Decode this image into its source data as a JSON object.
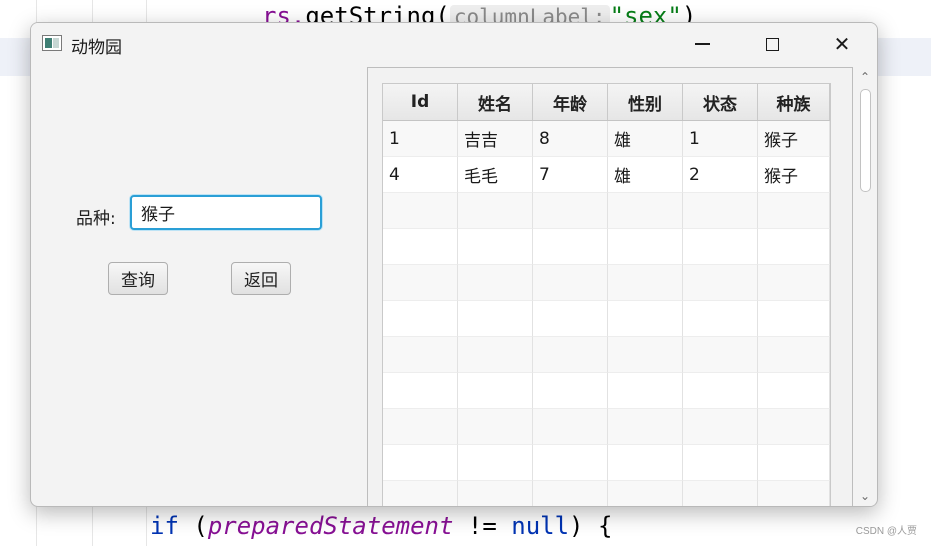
{
  "editor": {
    "top_line": {
      "prefix": "rs.",
      "method": "getString(",
      "hint": "columnLabel:",
      "arg": "\"sex\"",
      "suffix": ")"
    },
    "bottom_line": {
      "kw_if": "if",
      "open": " (",
      "field": "preparedStatement",
      "op": " != ",
      "kw_null": "null",
      "close": ") {"
    },
    "watermark": "CSDN @人贾"
  },
  "window": {
    "title": "动物园",
    "icon": "app-window-icon",
    "controls": {
      "minimize": "minimize-icon",
      "maximize": "maximize-icon",
      "close": "close-icon",
      "close_glyph": "✕"
    }
  },
  "form": {
    "breed_label": "品种:",
    "breed_value": "猴子",
    "query_button": "查询",
    "back_button": "返回"
  },
  "table": {
    "columns": [
      "Id",
      "姓名",
      "年龄",
      "性别",
      "状态",
      "种族"
    ],
    "rows": [
      [
        "1",
        "吉吉",
        "8",
        "雄",
        "1",
        "猴子"
      ],
      [
        "4",
        "毛毛",
        "7",
        "雄",
        "2",
        "猴子"
      ]
    ]
  },
  "scrollbar": {
    "up_icon": "chevron-up-icon",
    "down_icon": "chevron-down-icon",
    "up_glyph": "⌃",
    "down_glyph": "⌄"
  }
}
